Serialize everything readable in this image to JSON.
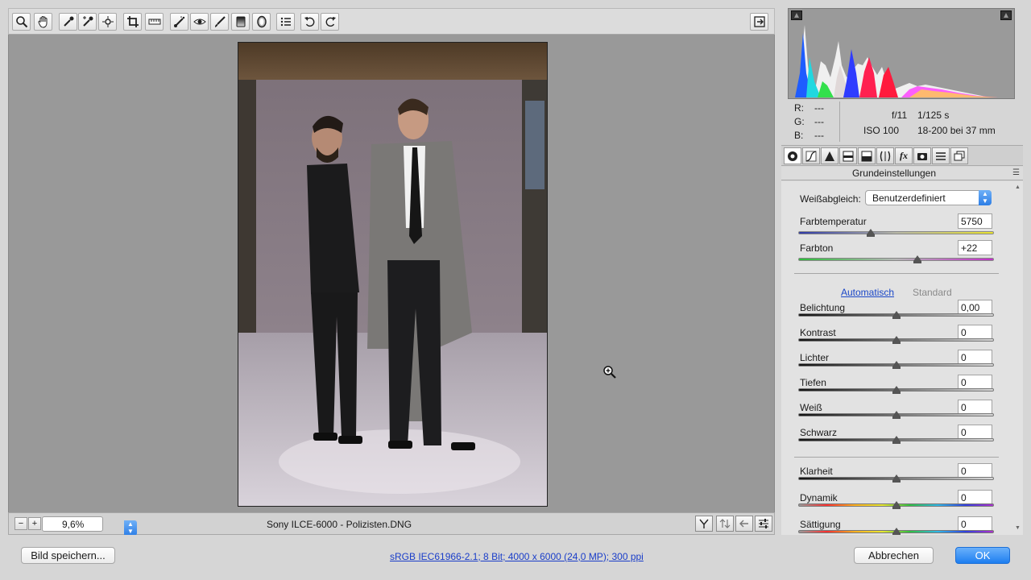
{
  "toolbar": {
    "tools": [
      {
        "name": "zoom-tool",
        "icon": "magnifier-icon"
      },
      {
        "name": "hand-tool",
        "icon": "hand-icon"
      },
      {
        "name": "white-balance-tool",
        "icon": "eyedropper-icon"
      },
      {
        "name": "color-sampler-tool",
        "icon": "color-sampler-icon"
      },
      {
        "name": "targeted-adjustment-tool",
        "icon": "target-adjust-icon"
      },
      {
        "name": "crop-tool",
        "icon": "crop-icon"
      },
      {
        "name": "straighten-tool",
        "icon": "ruler-icon"
      },
      {
        "name": "spot-removal-tool",
        "icon": "spot-brush-icon"
      },
      {
        "name": "red-eye-tool",
        "icon": "eye-icon"
      },
      {
        "name": "adjustment-brush-tool",
        "icon": "brush-icon"
      },
      {
        "name": "graduated-filter-tool",
        "icon": "graduated-filter-icon"
      },
      {
        "name": "radial-filter-tool",
        "icon": "radial-filter-icon"
      },
      {
        "name": "preferences-tool",
        "icon": "list-icon"
      },
      {
        "name": "rotate-left-tool",
        "icon": "rotate-left-icon"
      },
      {
        "name": "rotate-right-tool",
        "icon": "rotate-right-icon"
      }
    ],
    "fullscreen_icon": "fullscreen-toggle-icon"
  },
  "statusbar": {
    "zoom_value": "9,6%",
    "file_name": "Sony ILCE-6000 - Polizisten.DNG"
  },
  "info": {
    "r_label": "R:",
    "g_label": "G:",
    "b_label": "B:",
    "r_value": "---",
    "g_value": "---",
    "b_value": "---",
    "aperture": "f/11",
    "shutter": "1/125 s",
    "iso": "ISO 100",
    "lens": "18-200 bei 37 mm"
  },
  "panel": {
    "title": "Grundeinstellungen",
    "white_balance_label": "Weißabgleich:",
    "white_balance_value": "Benutzerdefiniert",
    "temperature": {
      "label": "Farbtemperatur",
      "value": "5750",
      "level": 0.37
    },
    "tint": {
      "label": "Farbton",
      "value": "+22",
      "level": 0.61
    },
    "auto_link": "Automatisch",
    "standard_link": "Standard",
    "tone": [
      {
        "label": "Belichtung",
        "value": "0,00",
        "level": 0.5
      },
      {
        "label": "Kontrast",
        "value": "0",
        "level": 0.5
      },
      {
        "label": "Lichter",
        "value": "0",
        "level": 0.5
      },
      {
        "label": "Tiefen",
        "value": "0",
        "level": 0.5
      },
      {
        "label": "Weiß",
        "value": "0",
        "level": 0.5
      },
      {
        "label": "Schwarz",
        "value": "0",
        "level": 0.5
      }
    ],
    "presence": [
      {
        "label": "Klarheit",
        "value": "0",
        "level": 0.5
      },
      {
        "label": "Dynamik",
        "value": "0",
        "level": 0.5
      },
      {
        "label": "Sättigung",
        "value": "0",
        "level": 0.5
      }
    ]
  },
  "footer": {
    "save_label": "Bild speichern...",
    "workflow_text": "sRGB IEC61966-2.1; 8 Bit; 4000 x 6000 (24,0 MP); 300 ppi",
    "cancel_label": "Abbrechen",
    "ok_label": "OK"
  },
  "colors": {
    "accent": "#2d7ee6",
    "canvas": "#999999",
    "link": "#1a47c8"
  }
}
